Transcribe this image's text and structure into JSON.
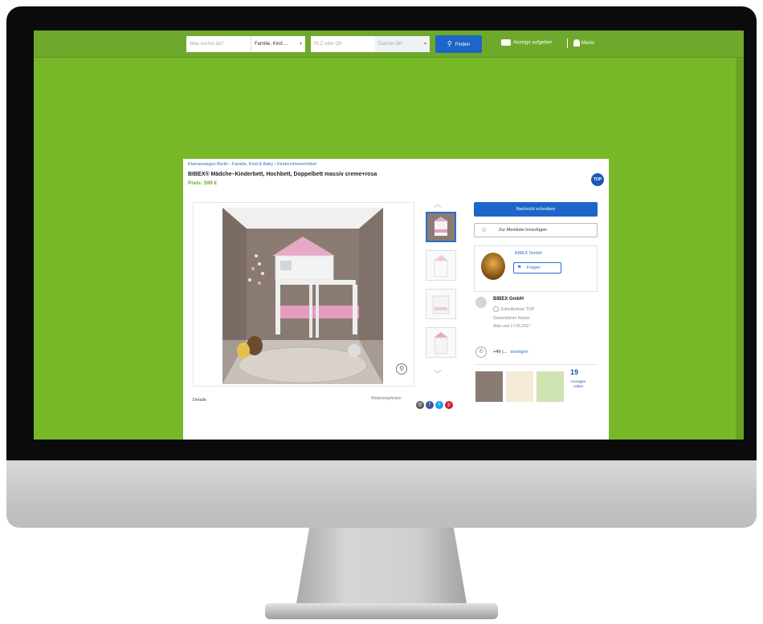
{
  "search": {
    "query_placeholder": "Was suchst du?",
    "category": "Familie, Kind ...",
    "location_placeholder": "PLZ oder Ort",
    "radius": "Ganzer Ort",
    "find_label": "Finden"
  },
  "header_links": {
    "post_ad": "Anzeige aufgeben",
    "my_account": "Meins"
  },
  "listing": {
    "breadcrumbs": "Kleinanzeigen Berlin ›   Familie, Kind & Baby ›   Kinderzimmermöbel",
    "title": "BIBEX® Mädche–Kinderbett, Hochbett, Doppelbett massiv creme+rosa",
    "price": "Preis: 599 €",
    "top_badge": "TOP",
    "details_label": "Details",
    "share_label": "Weiterempfehlen"
  },
  "actions": {
    "message_label": "Nachricht schreiben",
    "watchlist_label": "Zur Merkliste hinzufügen"
  },
  "seller": {
    "name": "BIBEX GmbH",
    "follow_label": "Folgen",
    "profile_name": "BIBEX GmbH",
    "satisfaction": "Zufriedenheit: TOP",
    "user_type": "Gewerblicher Nutzer",
    "active_since": "Aktiv seit 17.05.2017",
    "phone_prefix": "+49 (...",
    "phone_reveal": "anzeigen",
    "ads_count": "19",
    "ads_label": "Anzeigen online"
  },
  "colors": {
    "brand_green": "#76b82a",
    "link_blue": "#2a6dd2",
    "button_blue": "#1d65c8"
  },
  "icons": [
    "search-icon",
    "car-icon",
    "user-icon",
    "star-icon",
    "follow-icon",
    "phone-icon",
    "zoom-icon",
    "chevron-up-icon",
    "chevron-down-icon",
    "facebook-icon",
    "twitter-icon",
    "pinterest-icon"
  ]
}
